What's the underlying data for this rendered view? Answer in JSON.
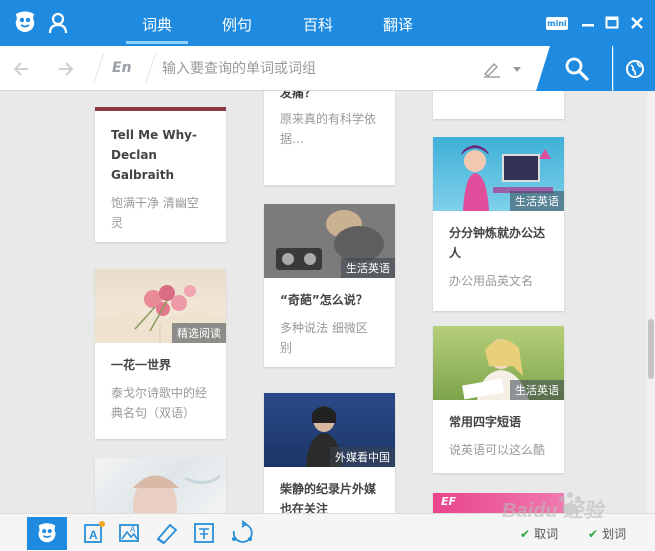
{
  "header": {
    "tabs": [
      {
        "label": "词典",
        "active": true
      },
      {
        "label": "例句",
        "active": false
      },
      {
        "label": "百科",
        "active": false
      },
      {
        "label": "翻译",
        "active": false
      }
    ],
    "mini_label": "mini"
  },
  "search": {
    "lang_label": "En",
    "placeholder": "输入要查询的单词或词组",
    "value": ""
  },
  "cards": [
    {
      "title": "Tell Me Why-Declan Galbraith",
      "desc": "饱满干净 清幽空灵"
    },
    {
      "title": "一花一世界",
      "desc": "泰戈尔诗歌中的经典名句（双语）",
      "tag": "精选阅读"
    },
    {
      "title": "",
      "desc": ""
    },
    {
      "title": "发痛？",
      "desc": "原来真的有科学依据…"
    },
    {
      "title": "“奇葩”怎么说？",
      "desc": "多种说法 细微区别",
      "tag": "生活英语"
    },
    {
      "title": "柴静的纪录片外媒也在关注",
      "desc": "",
      "tag": "外媒看中国"
    },
    {
      "title": "分分钟炼就办公达人",
      "desc": "办公用品英文名",
      "tag": "生活英语"
    },
    {
      "title": "常用四字短语",
      "desc": "说英语可以这么酷",
      "tag": "生活英语"
    },
    {
      "title": "",
      "desc": "",
      "tag": "EF"
    }
  ],
  "bottom": {
    "options": [
      {
        "label": "取词",
        "checked": true
      },
      {
        "label": "划词",
        "checked": true
      }
    ],
    "watermark": "Baidu 经验"
  },
  "colors": {
    "accent": "#1e8be0",
    "check": "#2aa644",
    "card_title": "#444444",
    "card_desc": "#999999"
  }
}
